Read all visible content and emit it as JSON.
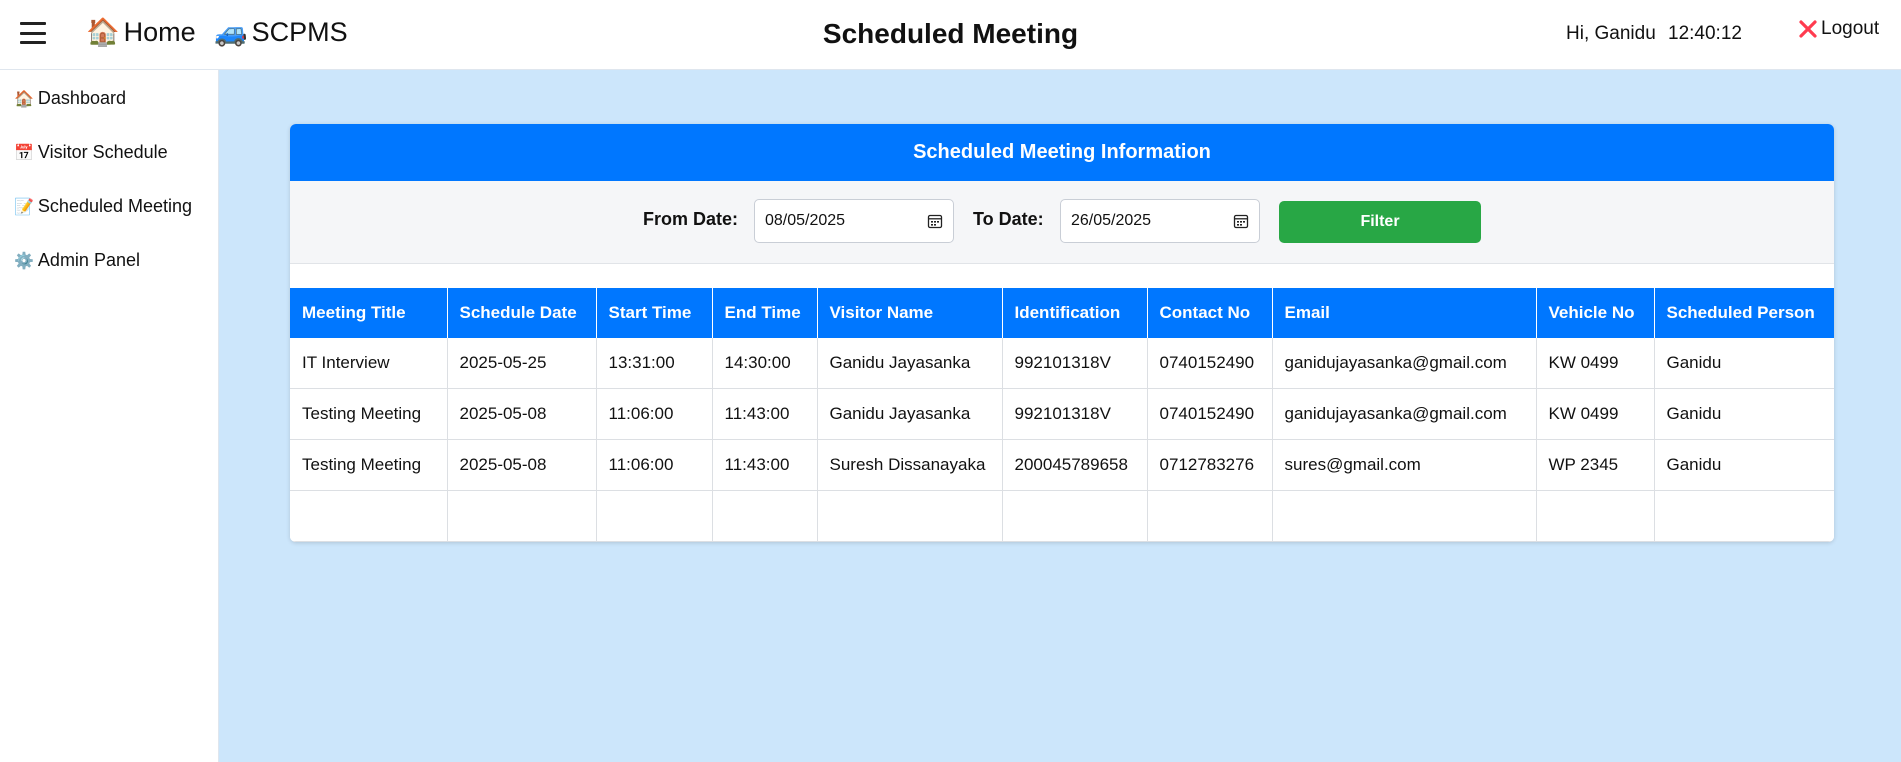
{
  "topbar": {
    "menu_icon": "hamburger-icon",
    "home_label": "Home",
    "home_icon": "🏠",
    "app_label": "SCPMS",
    "app_icon": "🚙",
    "page_title": "Scheduled Meeting",
    "greeting": "Hi, Ganidu",
    "clock": "12:40:12",
    "logout_label": "Logout",
    "logout_icon": "close-x-icon",
    "logout_icon_color": "#ff3b4f"
  },
  "sidebar": {
    "items": [
      {
        "icon": "🏠",
        "label": "Dashboard"
      },
      {
        "icon": "📅",
        "label": "Visitor Schedule"
      },
      {
        "icon": "📝",
        "label": "Scheduled Meeting"
      },
      {
        "icon": "⚙️",
        "label": "Admin Panel"
      }
    ]
  },
  "panel": {
    "title": "Scheduled Meeting Information",
    "header_color": "#0077ff",
    "filter": {
      "from_label": "From Date:",
      "from_value": "08/05/2025",
      "to_label": "To Date:",
      "to_value": "26/05/2025",
      "button_label": "Filter",
      "button_color": "#28a745"
    },
    "table": {
      "columns": [
        "Meeting Title",
        "Schedule Date",
        "Start Time",
        "End Time",
        "Visitor Name",
        "Identification",
        "Contact No",
        "Email",
        "Vehicle No",
        "Scheduled Person"
      ],
      "rows": [
        [
          "IT Interview",
          "2025-05-25",
          "13:31:00",
          "14:30:00",
          "Ganidu Jayasanka",
          "992101318V",
          "0740152490",
          "ganidujayasanka@gmail.com",
          "KW 0499",
          "Ganidu"
        ],
        [
          "Testing Meeting",
          "2025-05-08",
          "11:06:00",
          "11:43:00",
          "Ganidu Jayasanka",
          "992101318V",
          "0740152490",
          "ganidujayasanka@gmail.com",
          "KW 0499",
          "Ganidu"
        ],
        [
          "Testing Meeting",
          "2025-05-08",
          "11:06:00",
          "11:43:00",
          "Suresh Dissanayaka",
          "200045789658",
          "0712783276",
          "sures@gmail.com",
          "WP 2345",
          "Ganidu"
        ],
        [
          "",
          "",
          "",
          "",
          "",
          "",
          "",
          "",
          "",
          ""
        ]
      ]
    }
  }
}
